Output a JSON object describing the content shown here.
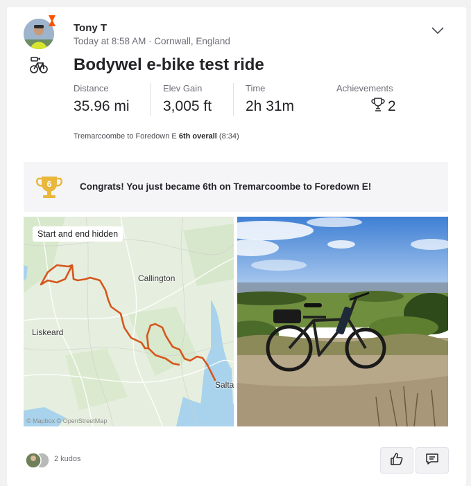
{
  "athlete": {
    "name": "Tony T",
    "meta": "Today at 8:58 AM · Cornwall, England"
  },
  "activity": {
    "title": "Bodywel e-bike test ride"
  },
  "stats": [
    {
      "label": "Distance",
      "value": "35.96 mi"
    },
    {
      "label": "Elev Gain",
      "value": "3,005 ft"
    },
    {
      "label": "Time",
      "value": "2h 31m"
    }
  ],
  "achievements": {
    "label": "Achievements",
    "count": "2"
  },
  "segment": {
    "name": "Tremarcoombe to Foredown E",
    "rank": "6th overall",
    "time": "(8:34)"
  },
  "congrats": {
    "badge_number": "6",
    "text": "Congrats! You just became 6th on Tremarcoombe to Foredown E!"
  },
  "map": {
    "privacy_label": "Start and end hidden",
    "places": [
      "Callington",
      "Liskeard",
      "Salta"
    ],
    "credit": "© Mapbox © OpenStreetMap",
    "route_color": "#d5561d"
  },
  "kudos": {
    "count_text": "2 kudos"
  },
  "icons": {
    "sport": "ebike-icon",
    "menu": "chevron-down-icon",
    "achievement": "trophy-icon",
    "kudos": "thumbs-up-icon",
    "comment": "comment-icon"
  },
  "colors": {
    "brand": "#fc5200",
    "trophy_gold": "#e9b73b",
    "text": "#242428",
    "muted": "#6d6d78"
  }
}
